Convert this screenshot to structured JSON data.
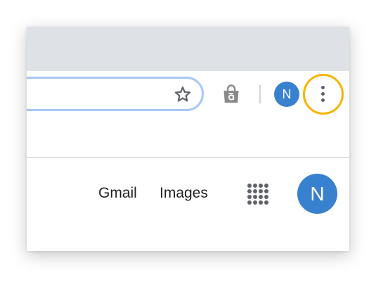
{
  "toolbar": {
    "profile_initial": "N",
    "icons": {
      "bookmark": "star-icon",
      "extension": "shopping-bag-icon",
      "menu": "more-vert-icon"
    }
  },
  "page": {
    "links": {
      "gmail": "Gmail",
      "images": "Images"
    },
    "apps_icon": "apps-grid-icon",
    "account_initial": "N"
  },
  "colors": {
    "avatar": "#3881cf",
    "highlight_ring": "#f5b400",
    "omnibox_border": "#a8c7fa",
    "tabstrip": "#dee1e6",
    "icon_gray": "#5f6368"
  }
}
